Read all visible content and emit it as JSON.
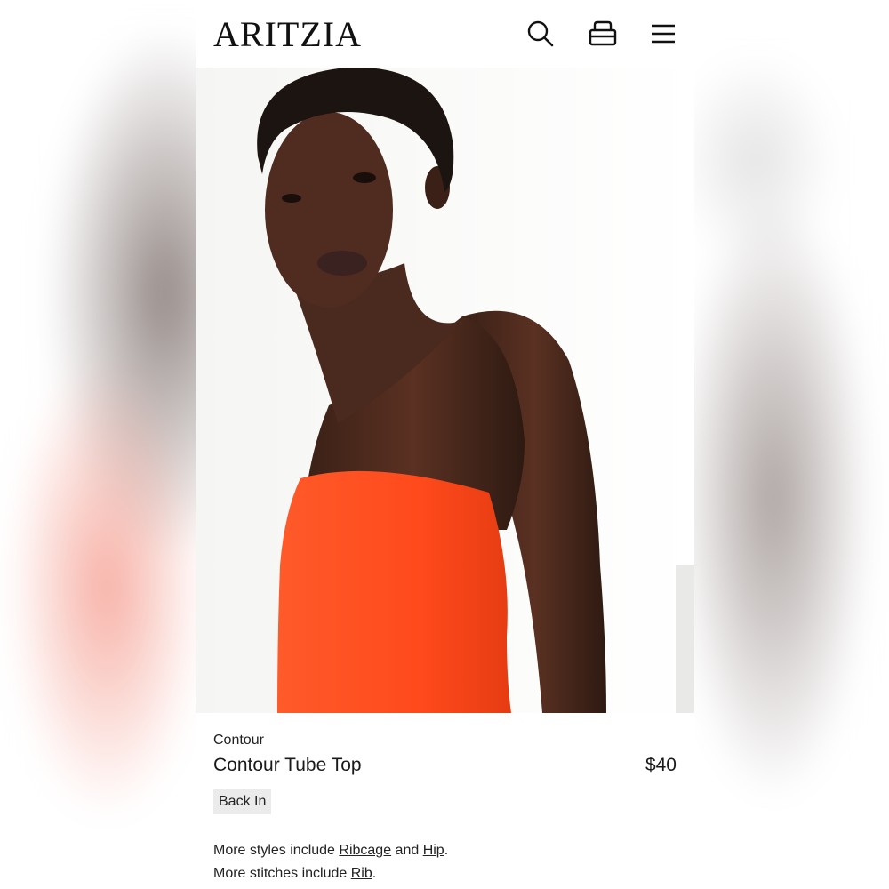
{
  "header": {
    "logo_text": "ARITZIA",
    "icons": [
      "search-icon",
      "bag-icon",
      "menu-icon"
    ]
  },
  "hero": {
    "alt": "Model wearing an orange strapless tube top"
  },
  "product": {
    "brand": "Contour",
    "name": "Contour Tube Top",
    "price": "$40",
    "badge": "Back In",
    "styles": {
      "prefix": "More styles include ",
      "link1": "Ribcage",
      "conjunction": " and ",
      "link2": "Hip",
      "suffix": "."
    },
    "stitches": {
      "prefix": "More stitches include ",
      "link1": "Rib",
      "suffix": "."
    }
  },
  "colors": {
    "top_orange": "#ff4a1c",
    "skin": "#4a2a1e",
    "hair": "#1c1410",
    "text": "#1a1a1a",
    "badge_bg": "#ebebeb"
  }
}
